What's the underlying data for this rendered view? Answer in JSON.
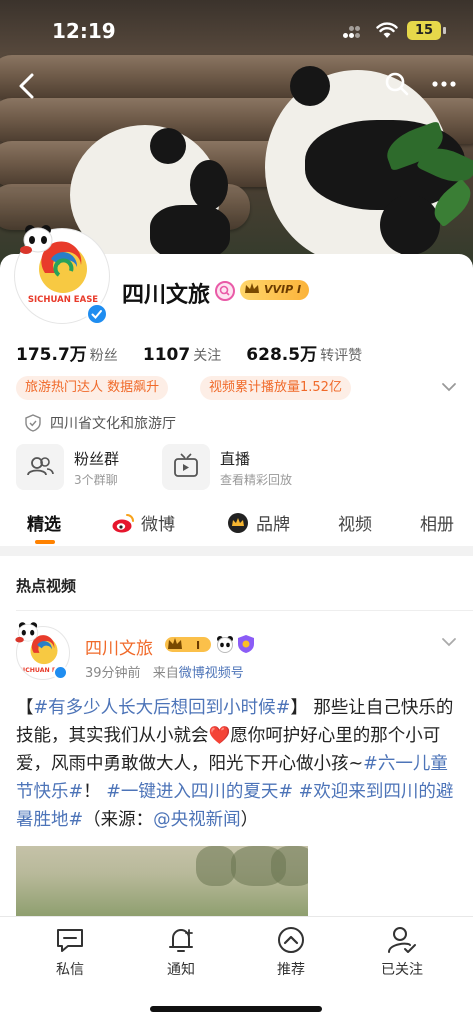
{
  "status_bar": {
    "time": "12:19",
    "battery": "15"
  },
  "profile": {
    "name": "四川文旅",
    "vvip_label": "VVIP",
    "vvip_level": "I",
    "avatar_text": "SICHUAN EASE",
    "stats": [
      {
        "value": "175.7万",
        "label": "粉丝"
      },
      {
        "value": "1107",
        "label": "关注"
      },
      {
        "value": "628.5万",
        "label": "转评赞"
      }
    ],
    "tags": [
      "旅游热门达人 数据飙升",
      "视频累计播放量1.52亿"
    ],
    "organization": "四川省文化和旅游厅",
    "quick_actions": [
      {
        "title": "粉丝群",
        "sub": "3个群聊",
        "icon": "fans-group-icon"
      },
      {
        "title": "直播",
        "sub": "查看精彩回放",
        "icon": "live-tv-icon"
      }
    ]
  },
  "tabs": [
    {
      "label": "精选",
      "active": true
    },
    {
      "label": "微博",
      "active": false
    },
    {
      "label": "品牌",
      "active": false
    },
    {
      "label": "视频",
      "active": false
    },
    {
      "label": "相册",
      "active": false
    }
  ],
  "section_title": "热点视频",
  "post": {
    "author": "四川文旅",
    "time_ago": "39分钟前",
    "source_prefix": "来自",
    "source": "微博视频号",
    "text": {
      "p1_bracket_open": "【",
      "tag1": "#有多少人长大后想回到小时候#",
      "p1_bracket_close": "】",
      "p2": "那些让自己快乐的技能，其实我们从小就会",
      "heart": "❤️",
      "p3": "愿你呵护好心里的那个小可爱，风雨中勇敢做大人，阳光下开心做小孩~",
      "tag2": "#六一儿童节快乐#",
      "p4": "！",
      "tag3": "#一键进入四川的夏天#",
      "tag4": "#欢迎来到四川的避暑胜地#",
      "p5": "（来源：",
      "mention": "@央视新闻",
      "p6": "）"
    }
  },
  "bottom_bar": [
    {
      "label": "私信",
      "icon": "message-icon"
    },
    {
      "label": "通知",
      "icon": "bell-icon"
    },
    {
      "label": "推荐",
      "icon": "recommend-icon"
    },
    {
      "label": "已关注",
      "icon": "followed-user-icon"
    }
  ],
  "colors": {
    "accent": "#ff8200",
    "link": "#4d74b8",
    "tag_bg": "#fdeee6",
    "tag_text": "#f06a2a",
    "verify": "#1f8df0"
  }
}
